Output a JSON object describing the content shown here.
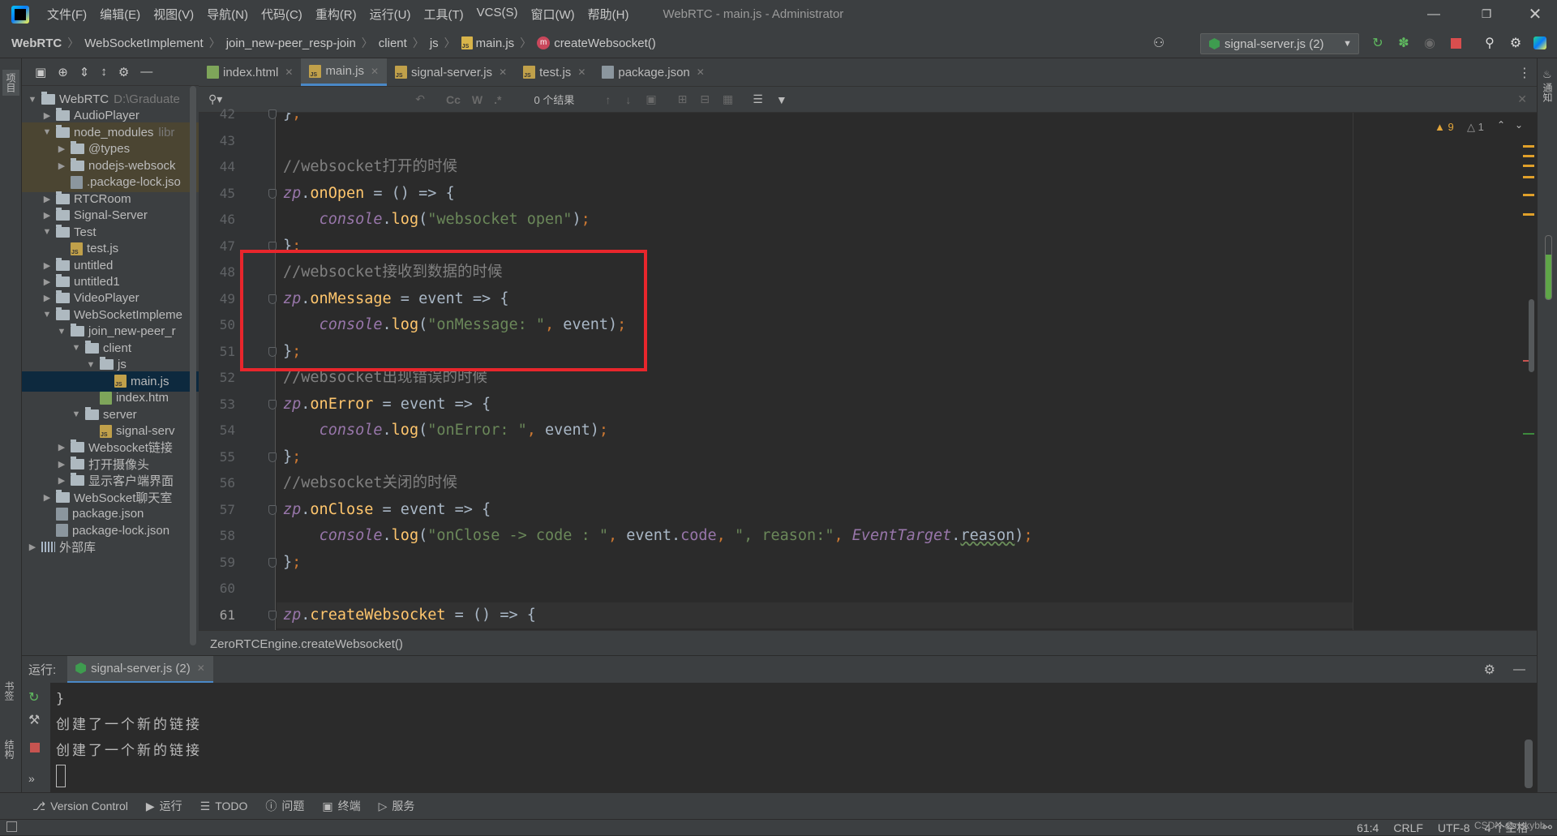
{
  "titlebar": {
    "menus": [
      "文件(F)",
      "编辑(E)",
      "视图(V)",
      "导航(N)",
      "代码(C)",
      "重构(R)",
      "运行(U)",
      "工具(T)",
      "VCS(S)",
      "窗口(W)",
      "帮助(H)"
    ],
    "title": "WebRTC - main.js - Administrator"
  },
  "navbar": {
    "crumbs": [
      "WebRTC",
      "WebSocketImplement",
      "join_new-peer_resp-join",
      "client",
      "js",
      "main.js",
      "createWebsocket()"
    ],
    "run_config": "signal-server.js (2)"
  },
  "project": {
    "rows": [
      {
        "label": "WebRTC",
        "extra": "D:\\Graduate",
        "depth": 0,
        "type": "folder",
        "open": true
      },
      {
        "label": "AudioPlayer",
        "depth": 1,
        "type": "folder",
        "open": false
      },
      {
        "label": "node_modules",
        "extra": "libr",
        "depth": 1,
        "type": "folder",
        "open": true,
        "lib": true
      },
      {
        "label": "@types",
        "depth": 2,
        "type": "folder",
        "open": false,
        "lib": true
      },
      {
        "label": "nodejs-websock",
        "depth": 2,
        "type": "folder",
        "open": false,
        "lib": true
      },
      {
        "label": ".package-lock.jso",
        "depth": 2,
        "type": "json",
        "lib": true
      },
      {
        "label": "RTCRoom",
        "depth": 1,
        "type": "folder",
        "open": false
      },
      {
        "label": "Signal-Server",
        "depth": 1,
        "type": "folder",
        "open": false
      },
      {
        "label": "Test",
        "depth": 1,
        "type": "folder",
        "open": true
      },
      {
        "label": "test.js",
        "depth": 2,
        "type": "js"
      },
      {
        "label": "untitled",
        "depth": 1,
        "type": "folder",
        "open": false
      },
      {
        "label": "untitled1",
        "depth": 1,
        "type": "folder",
        "open": false
      },
      {
        "label": "VideoPlayer",
        "depth": 1,
        "type": "folder",
        "open": false
      },
      {
        "label": "WebSocketImpleme",
        "depth": 1,
        "type": "folder",
        "open": true
      },
      {
        "label": "join_new-peer_r",
        "depth": 2,
        "type": "folder",
        "open": true
      },
      {
        "label": "client",
        "depth": 3,
        "type": "folder",
        "open": true
      },
      {
        "label": "js",
        "depth": 4,
        "type": "folder",
        "open": true
      },
      {
        "label": "main.js",
        "depth": 5,
        "type": "js",
        "selected": true
      },
      {
        "label": "index.htm",
        "depth": 4,
        "type": "html"
      },
      {
        "label": "server",
        "depth": 3,
        "type": "folder",
        "open": true
      },
      {
        "label": "signal-serv",
        "depth": 4,
        "type": "js"
      },
      {
        "label": "Websocket链接",
        "depth": 2,
        "type": "folder",
        "open": false
      },
      {
        "label": "打开摄像头",
        "depth": 2,
        "type": "folder",
        "open": false
      },
      {
        "label": "显示客户端界面",
        "depth": 2,
        "type": "folder",
        "open": false
      },
      {
        "label": "WebSocket聊天室",
        "depth": 1,
        "type": "folder",
        "open": false
      },
      {
        "label": "package.json",
        "depth": 1,
        "type": "json"
      },
      {
        "label": "package-lock.json",
        "depth": 1,
        "type": "json"
      },
      {
        "label": "外部库",
        "depth": 0,
        "type": "lib",
        "open": false
      }
    ]
  },
  "leftstrip": {
    "project_label": "项目",
    "bookmarks_label": "书签",
    "structure_label": "结构"
  },
  "rightstrip": {
    "notifications_label": "通知"
  },
  "tabs": [
    {
      "label": "index.html",
      "type": "html"
    },
    {
      "label": "main.js",
      "type": "js",
      "active": true
    },
    {
      "label": "signal-server.js",
      "type": "js"
    },
    {
      "label": "test.js",
      "type": "js"
    },
    {
      "label": "package.json",
      "type": "json"
    }
  ],
  "findbar": {
    "results": "0 个结果",
    "case_label": "Cc",
    "word_label": "W",
    "regex_label": ".*"
  },
  "inspection": {
    "warnings": "9",
    "weak_warnings": "1"
  },
  "editor": {
    "lines": [
      {
        "n": "42",
        "code": "};"
      },
      {
        "n": "43",
        "code": ""
      },
      {
        "n": "44",
        "code": "//websocket打开的时候"
      },
      {
        "n": "45",
        "code": "zp.onOpen = () => {"
      },
      {
        "n": "46",
        "code": "    console.log(\"websocket open\");"
      },
      {
        "n": "47",
        "code": "};"
      },
      {
        "n": "48",
        "code": "//websocket接收到数据的时候"
      },
      {
        "n": "49",
        "code": "zp.onMessage = event => {"
      },
      {
        "n": "50",
        "code": "    console.log(\"onMessage: \", event);"
      },
      {
        "n": "51",
        "code": "};"
      },
      {
        "n": "52",
        "code": "//websocket出现错误的时候"
      },
      {
        "n": "53",
        "code": "zp.onError = event => {"
      },
      {
        "n": "54",
        "code": "    console.log(\"onError: \", event);"
      },
      {
        "n": "55",
        "code": "};"
      },
      {
        "n": "56",
        "code": "//websocket关闭的时候"
      },
      {
        "n": "57",
        "code": "zp.onClose = event => {"
      },
      {
        "n": "58",
        "code": "    console.log(\"onClose -> code : \", event.code, \", reason:\", EventTarget.reason);"
      },
      {
        "n": "59",
        "code": "};"
      },
      {
        "n": "60",
        "code": ""
      },
      {
        "n": "61",
        "code": "zp.createWebsocket = () => {"
      }
    ],
    "breadcrumb": "ZeroRTCEngine.createWebsocket()"
  },
  "run": {
    "label": "运行:",
    "tab": "signal-server.js (2)",
    "console": [
      "}",
      "创建了一个新的链接",
      "创建了一个新的链接"
    ]
  },
  "tooltabs": [
    "Version Control",
    "运行",
    "TODO",
    "问题",
    "终端",
    "服务"
  ],
  "status": {
    "position": "61:4",
    "line_sep": "CRLF",
    "encoding": "UTF-8",
    "indent": "4 个空格",
    "watermark": "CSDN @nskybb"
  },
  "memory_usage": 0.7,
  "colors": {
    "accent": "#4a88c7",
    "highlight_box": "#e8262c",
    "background": "#2b2b2b",
    "panel": "#3c3f41"
  }
}
